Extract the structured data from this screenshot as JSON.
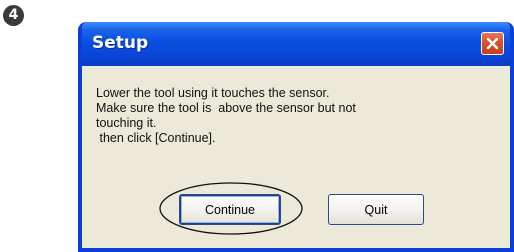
{
  "step": {
    "badge": "4"
  },
  "dialog": {
    "title": "Setup",
    "message_lines": [
      "Lower the tool using it touches the sensor.",
      "Make sure the tool is  above the sensor but not",
      "touching it.",
      " then click [Continue]."
    ],
    "buttons": {
      "continue_label": "Continue",
      "quit_label": "Quit"
    }
  },
  "colors": {
    "titlebar_blue": "#0a4fe0",
    "dialog_face": "#ece9d8",
    "close_red": "#d7502d"
  },
  "icons": {
    "close": "close-x-icon"
  }
}
